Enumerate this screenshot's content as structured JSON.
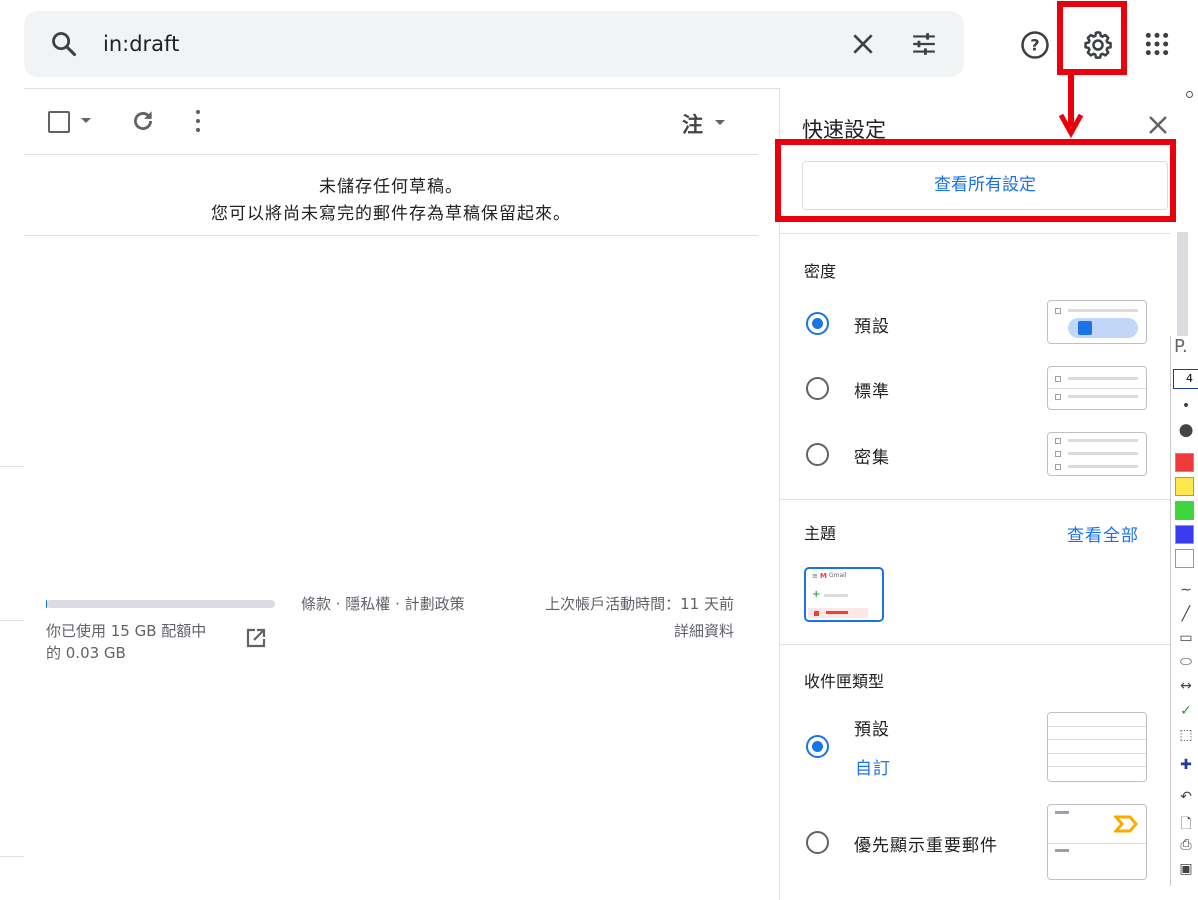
{
  "search": {
    "query": "in:draft"
  },
  "toolbar": {
    "sort_label": "注"
  },
  "empty_state": {
    "line1": "未儲存任何草稿。",
    "line2": "您可以將尚未寫完的郵件存為草稿保留起來。"
  },
  "footer": {
    "storage_line1": "你已使用 15 GB 配額中",
    "storage_line2": "的 0.03 GB",
    "storage_used_fraction": 0.002,
    "links": "條款 · 隱私權 · 計劃政策",
    "last_activity": "上次帳戶活動時間：11 天前",
    "details": "詳細資料"
  },
  "quick_settings": {
    "title": "快速設定",
    "see_all_settings": "查看所有設定",
    "density": {
      "title": "密度",
      "options": [
        {
          "label": "預設",
          "checked": true
        },
        {
          "label": "標準",
          "checked": false
        },
        {
          "label": "密集",
          "checked": false
        }
      ]
    },
    "theme": {
      "title": "主題",
      "see_all": "查看全部",
      "thumb_brand": "Gmail"
    },
    "inbox_type": {
      "title": "收件匣類型",
      "options": [
        {
          "label": "預設",
          "custom": "自訂",
          "checked": true
        },
        {
          "label": "優先顯示重要郵件",
          "checked": false
        }
      ]
    }
  },
  "drawing_tools": {
    "label": "P.",
    "value": "4",
    "colors": [
      "#ef3b3b",
      "#ffe84d",
      "#3dd63d",
      "#3b3bef",
      "#ffffff"
    ]
  },
  "colors": {
    "accent_blue": "#1a73e8",
    "highlight_red": "#e8000d"
  }
}
